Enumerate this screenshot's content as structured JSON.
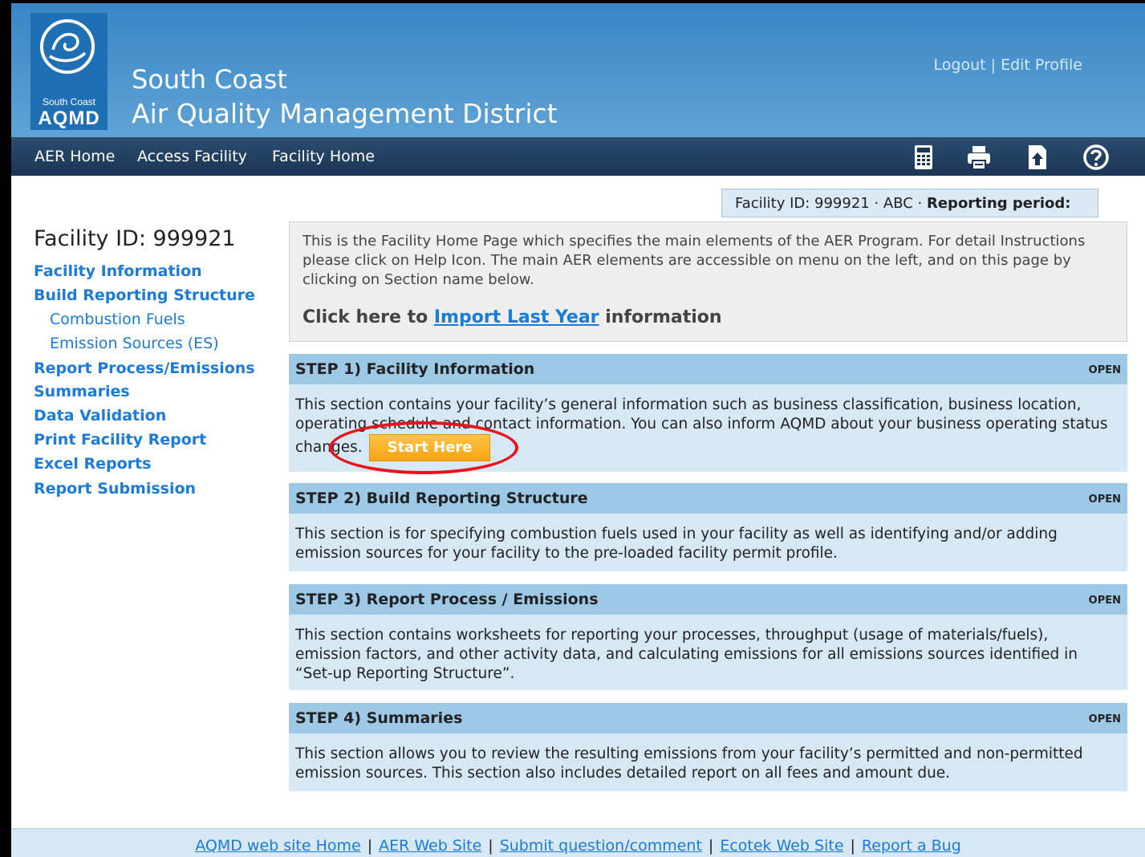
{
  "header": {
    "logo_line1": "South Coast",
    "logo_line2": "AQMD",
    "org_line1": "South Coast",
    "org_line2": "Air Quality Management District",
    "logout": "Logout",
    "edit_profile": "Edit Profile",
    "link_sep": " | "
  },
  "nav": {
    "items": [
      "AER Home",
      "Access Facility",
      "Facility Home"
    ],
    "icons": [
      "calculator-icon",
      "printer-icon",
      "upload-icon",
      "help-icon"
    ]
  },
  "id_strip": {
    "text": "Facility ID: 999921 · ABC · ",
    "bold": "Reporting period:"
  },
  "sidebar": {
    "title": "Facility ID: 999921",
    "items": [
      {
        "label": "Facility Information"
      },
      {
        "label": "Build Reporting Structure"
      },
      {
        "label": "Combustion Fuels"
      },
      {
        "label": "Emission Sources (ES)"
      },
      {
        "label": "Report Process/Emissions"
      },
      {
        "label": "Summaries"
      },
      {
        "label": "Data Validation"
      },
      {
        "label": "Print Facility Report"
      },
      {
        "label": "Excel Reports"
      },
      {
        "label": "Report Submission"
      }
    ]
  },
  "intro": {
    "text": "This is the Facility Home Page which specifies the main elements of the AER Program. For detail Instructions please click on Help Icon. The main AER elements are accessible on menu on the left, and on this page by clicking on Section name below.",
    "import_prefix": "Click here to ",
    "import_link": "Import Last Year",
    "import_suffix": " information"
  },
  "steps": [
    {
      "title": "STEP 1) Facility Information",
      "status": "OPEN",
      "body": "This section contains your facility’s general information such as business classification, business location, operating schedule and contact information. You can also inform AQMD about your business operating status changes.",
      "button": "Start Here"
    },
    {
      "title": "STEP 2) Build Reporting Structure",
      "status": "OPEN",
      "body": "This section is for specifying combustion fuels used in your facility as well as identifying and/or adding emission sources for your facility to the pre-loaded facility permit profile."
    },
    {
      "title": "STEP 3) Report Process / Emissions",
      "status": "OPEN",
      "body": "This section contains worksheets for reporting your processes, throughput (usage of materials/fuels), emission factors, and other activity data, and calculating emissions for all emissions sources identified in “Set-up Reporting Structure”."
    },
    {
      "title": "STEP 4) Summaries",
      "status": "OPEN",
      "body": "This section allows you to review the resulting emissions from your facility’s permitted and non-permitted emission sources. This section also includes detailed report on all fees and amount due."
    }
  ],
  "footer": {
    "links": [
      "AQMD web site Home",
      "AER Web Site",
      "Submit question/comment",
      "Ecotek Web Site",
      "Report a Bug"
    ],
    "sep": "|"
  },
  "colors": {
    "header_top": "#3a86c4",
    "nav_bg": "#1a3555",
    "link": "#1a7bd9",
    "step_head": "#9dc9e6",
    "step_body": "#d7e8f5",
    "button": "#f7a413",
    "annotation": "#e8141b"
  }
}
